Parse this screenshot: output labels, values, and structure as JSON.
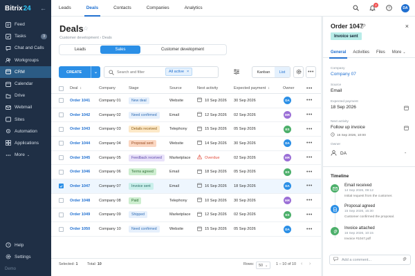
{
  "app": {
    "brand_name": "Bitrix",
    "brand_number": "24",
    "footer_note": "Demo"
  },
  "sidebar": {
    "items": [
      {
        "label": "Feed",
        "icon": "feed-icon"
      },
      {
        "label": "Tasks",
        "icon": "tasks-icon",
        "badge": "3"
      },
      {
        "label": "Chat and Calls",
        "icon": "chat-icon"
      },
      {
        "label": "Workgroups",
        "icon": "workgroups-icon"
      },
      {
        "label": "CRM",
        "icon": "crm-icon",
        "active": true
      },
      {
        "label": "Calendar",
        "icon": "calendar-icon"
      },
      {
        "label": "Drive",
        "icon": "drive-icon"
      },
      {
        "label": "Webmail",
        "icon": "mail-icon"
      },
      {
        "label": "Sites",
        "icon": "sites-icon"
      },
      {
        "label": "Automation",
        "icon": "automation-icon"
      },
      {
        "label": "Applications",
        "icon": "applications-icon"
      },
      {
        "label": "More",
        "icon": "more-icon"
      }
    ],
    "bottom": [
      {
        "label": "Help",
        "icon": "help-icon"
      },
      {
        "label": "Settings",
        "icon": "settings-icon"
      }
    ]
  },
  "topbar": {
    "tabs": [
      {
        "label": "Leads"
      },
      {
        "label": "Deals",
        "active": true
      },
      {
        "label": "Contacts"
      },
      {
        "label": "Companies"
      },
      {
        "label": "Analytics"
      }
    ],
    "notification_count": "2",
    "user_initials": "DA"
  },
  "page": {
    "title": "Deals",
    "breadcrumb": "Customer development  ›  Deals",
    "segments": [
      {
        "label": "Leads"
      },
      {
        "label": "Sales",
        "active": true
      },
      {
        "label": "Customer development"
      }
    ]
  },
  "toolbar": {
    "create_label": "CREATE",
    "search_placeholder": "Search and filter",
    "filter_chip": "All active",
    "view_kanban": "Kanban",
    "view_list": "List"
  },
  "table": {
    "headers": {
      "deal": "Deal",
      "company": "Company",
      "stage": "Stage",
      "source": "Source",
      "next_activity": "Next activity",
      "expected_payment": "Expected payment",
      "owner": "Owner"
    },
    "rows": [
      {
        "deal": "Order 1041",
        "company": "Company 01",
        "stage": "New deal",
        "stage_bg": "#e6f0fc",
        "stage_fg": "#2f6db5",
        "source": "Website",
        "next_activity": "10 Sep 2026",
        "overdue": false,
        "expected": "30 Sep 2026",
        "owner": "DA",
        "owner_color": "#2b8fe6",
        "selected": false
      },
      {
        "deal": "Order 1042",
        "company": "Company 02",
        "stage": "Need confirmed",
        "stage_bg": "#e6f0fc",
        "stage_fg": "#2f6db5",
        "source": "Email",
        "next_activity": "12 Sep 2026",
        "overdue": false,
        "expected": "02 Sep 2026",
        "owner": "MR",
        "owner_color": "#9b6fd6",
        "selected": false
      },
      {
        "deal": "Order 1043",
        "company": "Company 03",
        "stage": "Details received",
        "stage_bg": "#fde9c8",
        "stage_fg": "#8a5a12",
        "source": "Telephony",
        "next_activity": "15 Sep 2026",
        "overdue": false,
        "expected": "05 Sep 2026",
        "owner": "ES",
        "owner_color": "#4caf6a",
        "selected": false
      },
      {
        "deal": "Order 1044",
        "company": "Company 04",
        "stage": "Proposal sent",
        "stage_bg": "#fbd7c2",
        "stage_fg": "#9a4a1e",
        "source": "Website",
        "next_activity": "14 Sep 2026",
        "overdue": false,
        "expected": "30 Sep 2026",
        "owner": "DA",
        "owner_color": "#2b8fe6",
        "selected": false
      },
      {
        "deal": "Order 1045",
        "company": "Company 05",
        "stage": "Feedback received",
        "stage_bg": "#e9e2fa",
        "stage_fg": "#5b45a8",
        "source": "Marketplace",
        "next_activity": "Overdue",
        "overdue": true,
        "expected": "02 Sep 2026",
        "owner": "MR",
        "owner_color": "#9b6fd6",
        "selected": false
      },
      {
        "deal": "Order 1046",
        "company": "Company 06",
        "stage": "Terms agreed",
        "stage_bg": "#cdeecf",
        "stage_fg": "#2e6e35",
        "source": "Email",
        "next_activity": "18 Sep 2026",
        "overdue": false,
        "expected": "05 Sep 2026",
        "owner": "ES",
        "owner_color": "#4caf6a",
        "selected": false
      },
      {
        "deal": "Order 1047",
        "company": "Company 07",
        "stage": "Invoice sent",
        "stage_bg": "#c9efeb",
        "stage_fg": "#236a62",
        "source": "Email",
        "next_activity": "16 Sep 2026",
        "overdue": false,
        "expected": "18 Sep 2026",
        "owner": "DA",
        "owner_color": "#2b8fe6",
        "selected": true
      },
      {
        "deal": "Order 1048",
        "company": "Company 08",
        "stage": "Paid",
        "stage_bg": "#cdeecf",
        "stage_fg": "#2e6e35",
        "source": "Telephony",
        "next_activity": "10 Sep 2026",
        "overdue": false,
        "expected": "30 Sep 2026",
        "owner": "MR",
        "owner_color": "#9b6fd6",
        "selected": false
      },
      {
        "deal": "Order 1049",
        "company": "Company 09",
        "stage": "Shipped",
        "stage_bg": "#e6f0fc",
        "stage_fg": "#2f6db5",
        "source": "Marketplace",
        "next_activity": "12 Sep 2026",
        "overdue": false,
        "expected": "02 Sep 2026",
        "owner": "ES",
        "owner_color": "#4caf6a",
        "selected": false
      },
      {
        "deal": "Order 1050",
        "company": "Company 10",
        "stage": "Need confirmed",
        "stage_bg": "#e6f0fc",
        "stage_fg": "#2f6db5",
        "source": "Website",
        "next_activity": "15 Sep 2026",
        "overdue": false,
        "expected": "05 Sep 2026",
        "owner": "DA",
        "owner_color": "#2b8fe6",
        "selected": false
      }
    ]
  },
  "footer": {
    "selected_label": "Selected:",
    "selected_value": "1",
    "total_label": "Total:",
    "total_value": "10",
    "rows_label": "Rows:",
    "rows_value": "50",
    "range": "1 – 10 of 10"
  },
  "panel": {
    "title": "Order 1047",
    "status": "Invoice sent",
    "tabs": [
      {
        "label": "General",
        "active": true
      },
      {
        "label": "Activities"
      },
      {
        "label": "Files"
      },
      {
        "label": "More"
      }
    ],
    "fields": {
      "company_label": "Company",
      "company_value": "Company 07",
      "source_label": "Source",
      "source_value": "Email",
      "expected_label": "Expected payment",
      "expected_value": "18 Sep 2026",
      "next_label": "Next activity",
      "next_value": "Follow up invoice",
      "next_time": "16 Sep 2026, 10:00",
      "owner_label": "Owner",
      "owner_value": "DA"
    },
    "timeline_title": "Timeline",
    "timeline": [
      {
        "title": "Email received",
        "date": "14 Sep 2026, 09:12",
        "sub": "Initial request from the customer.",
        "color": "#4caf6a",
        "icon": "mail-icon"
      },
      {
        "title": "Proposal agreed",
        "date": "15 Sep 2026, 15:30",
        "sub": "Customer confirmed the proposal.",
        "color": "#2b8fe6",
        "icon": "document-icon"
      },
      {
        "title": "Invoice attached",
        "date": "16 Sep 2026, 10:15",
        "sub": "Invoice #1047.pdf",
        "color": "#4caf6a",
        "icon": "attachment-icon"
      }
    ],
    "comment_placeholder": "Add a comment..."
  }
}
